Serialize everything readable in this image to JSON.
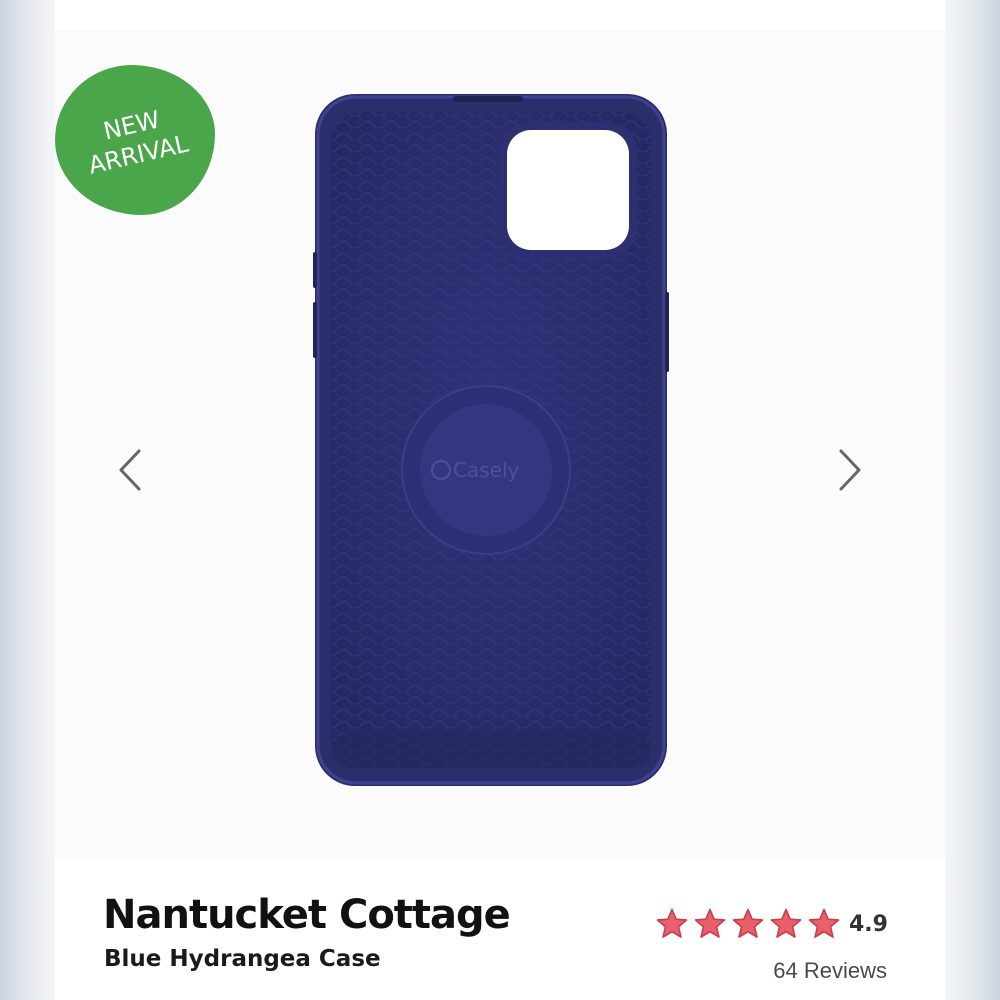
{
  "badge": {
    "text": "NEW\nARRIVAL",
    "color": "#4ba64b"
  },
  "gallery": {
    "prev_icon": "chevron-left-icon",
    "next_icon": "chevron-right-icon",
    "case_color": "#2c2e6b",
    "case_logo": "Casely"
  },
  "product": {
    "title": "Nantucket Cottage",
    "subtitle": "Blue Hydrangea Case"
  },
  "rating": {
    "stars": 5,
    "value": "4.9",
    "reviews": "64 Reviews",
    "star_color": "#e8606a"
  }
}
